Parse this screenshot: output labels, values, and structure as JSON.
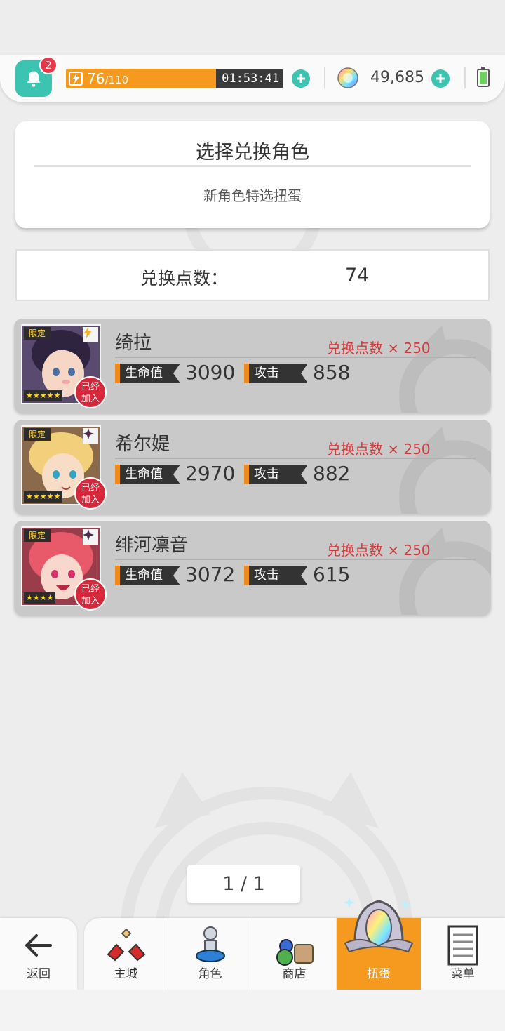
{
  "header": {
    "notification_count": "2",
    "stamina_current": "76",
    "stamina_max": "/110",
    "stamina_fraction": 0.69,
    "timer": "01:53:41",
    "gems": "49,685"
  },
  "title_card": {
    "title": "选择兑换角色",
    "subtitle": "新角色特选扭蛋"
  },
  "points": {
    "label": "兑换点数：",
    "value": "74"
  },
  "characters": [
    {
      "name": "绮拉",
      "cost": "兑换点数 × 250",
      "hp_label": "生命值",
      "hp": "3090",
      "atk_label": "攻击",
      "atk": "858",
      "limited": "限定",
      "stars": "★★★★★",
      "joined": "已经加入",
      "type_icon": "lightning-icon"
    },
    {
      "name": "希尔媞",
      "cost": "兑换点数 × 250",
      "hp_label": "生命值",
      "hp": "2970",
      "atk_label": "攻击",
      "atk": "882",
      "limited": "限定",
      "stars": "★★★★★",
      "joined": "已经加入",
      "type_icon": "star-icon"
    },
    {
      "name": "绯河凛音",
      "cost": "兑换点数 × 250",
      "hp_label": "生命值",
      "hp": "3072",
      "atk_label": "攻击",
      "atk": "615",
      "limited": "限定",
      "stars": "★★★★",
      "joined": "已经加入",
      "type_icon": "star-icon"
    }
  ],
  "pager": {
    "text": "1 / 1"
  },
  "nav": {
    "back": "返回",
    "items": [
      {
        "label": "主城",
        "icon": "castle-icon"
      },
      {
        "label": "角色",
        "icon": "character-icon"
      },
      {
        "label": "商店",
        "icon": "shop-icon"
      },
      {
        "label": "扭蛋",
        "icon": "gacha-icon",
        "active": true
      },
      {
        "label": "菜单",
        "icon": "menu-icon"
      }
    ]
  },
  "colors": {
    "accent_teal": "#3cc3b2",
    "stamina_orange": "#f59a1f",
    "cost_red": "#d23a3a",
    "badge_red": "#d6283b"
  }
}
